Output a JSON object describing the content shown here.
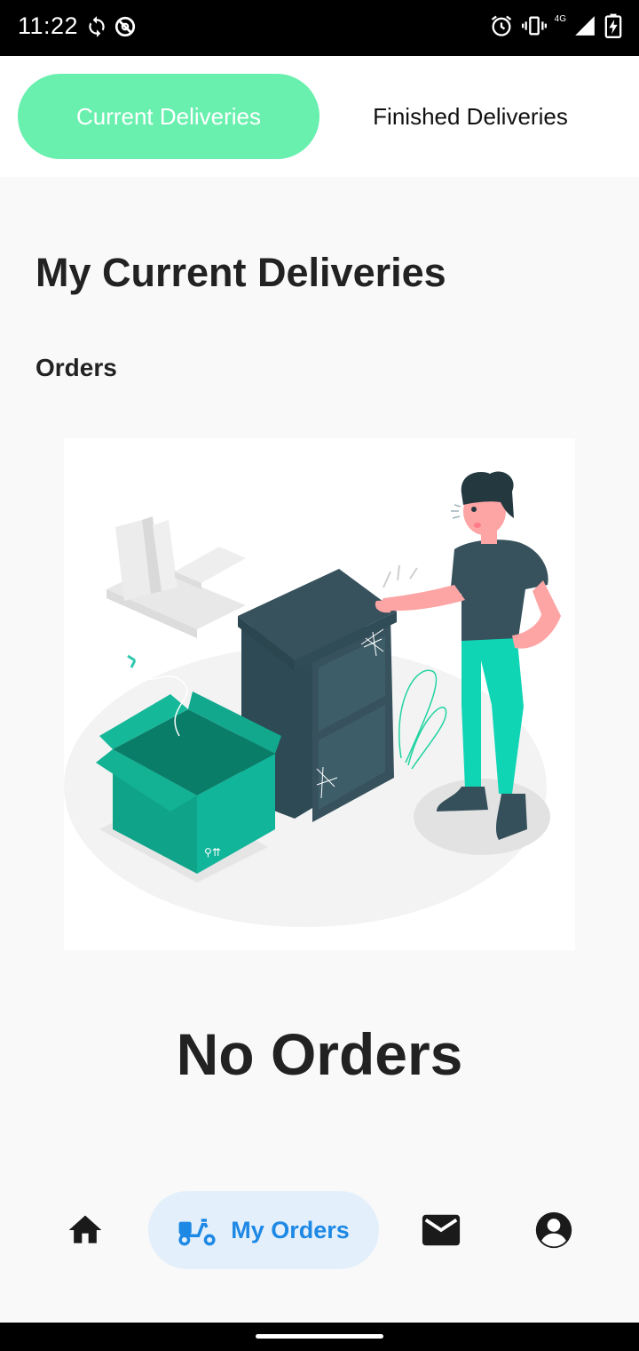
{
  "status_bar": {
    "time": "11:22",
    "network": "4G",
    "left_icons": [
      "sync-icon",
      "do-not-disturb-icon"
    ],
    "right_icons": [
      "alarm-icon",
      "vibrate-icon",
      "signal-icon",
      "battery-charging-icon"
    ]
  },
  "tabs": {
    "current_label": "Current Deliveries",
    "finished_label": "Finished Deliveries",
    "active": "current",
    "accent_color": "#69f0ae"
  },
  "main": {
    "title": "My Current Deliveries",
    "section_label": "Orders",
    "empty_message": "No Orders",
    "illustration": "empty-box-illustration"
  },
  "bottom_nav": {
    "items": [
      {
        "icon": "home-icon"
      },
      {
        "icon": "delivery-scooter-icon",
        "label": "My Orders",
        "active": true
      },
      {
        "icon": "mail-icon"
      },
      {
        "icon": "account-circle-icon"
      }
    ],
    "active_color": "#1e88e5"
  }
}
